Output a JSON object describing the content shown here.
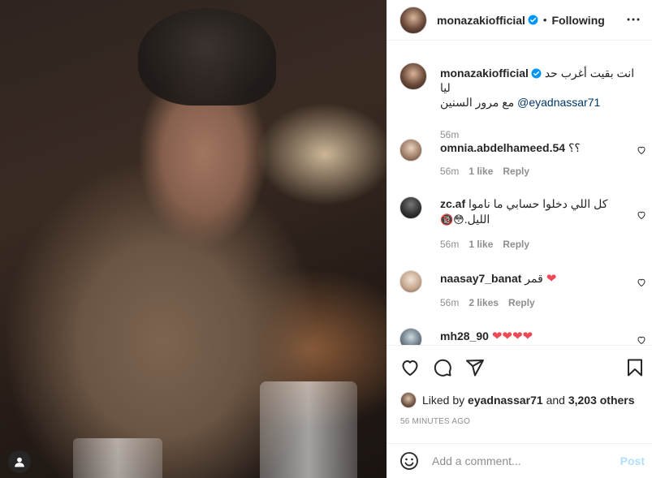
{
  "post": {
    "photo_alt": "",
    "user_tag_icon": "user-icon"
  },
  "header": {
    "username": "monazakiofficial",
    "separator": "•",
    "follow_status": "Following",
    "more_icon": "more-horizontal-icon"
  },
  "caption": {
    "username": "monazakiofficial",
    "text": "انت بقيت أغرب حد ليا",
    "mention": "@eyadnassar71",
    "text_2": "مع مرور السنين",
    "time": "56m"
  },
  "comments": [
    {
      "username": "omnia.abdelhameed.54",
      "text": "؟؟",
      "time": "56m",
      "likes": "1 like",
      "reply": "Reply"
    },
    {
      "username": "zc.af",
      "text": "كل اللي دخلوا حسابي ما ناموا",
      "text_2": "الليل.",
      "emoji": "🔞😳",
      "time": "56m",
      "likes": "1 like",
      "reply": "Reply"
    },
    {
      "username": "naasay7_banat",
      "text": "قمر",
      "emoji": "❤",
      "time": "56m",
      "likes": "2 likes",
      "reply": "Reply"
    },
    {
      "username": "mh28_90",
      "emoji": "❤❤❤❤"
    }
  ],
  "actions": {
    "like_icon": "heart-icon",
    "comment_icon": "comment-icon",
    "share_icon": "share-icon",
    "save_icon": "bookmark-icon"
  },
  "likes": {
    "prefix": "Liked by",
    "user": "eyadnassar71",
    "middle": "and",
    "others": "3,203 others"
  },
  "time_ago": "56 MINUTES AGO",
  "add_comment": {
    "placeholder": "Add a comment...",
    "post_label": "Post",
    "emoji_icon": "emoji-icon"
  },
  "colors": {
    "verified": "#0095f6",
    "link": "#00376b",
    "heart": "#ed4956",
    "post_disabled": "#b2dffc",
    "muted": "#8e8e8e"
  }
}
